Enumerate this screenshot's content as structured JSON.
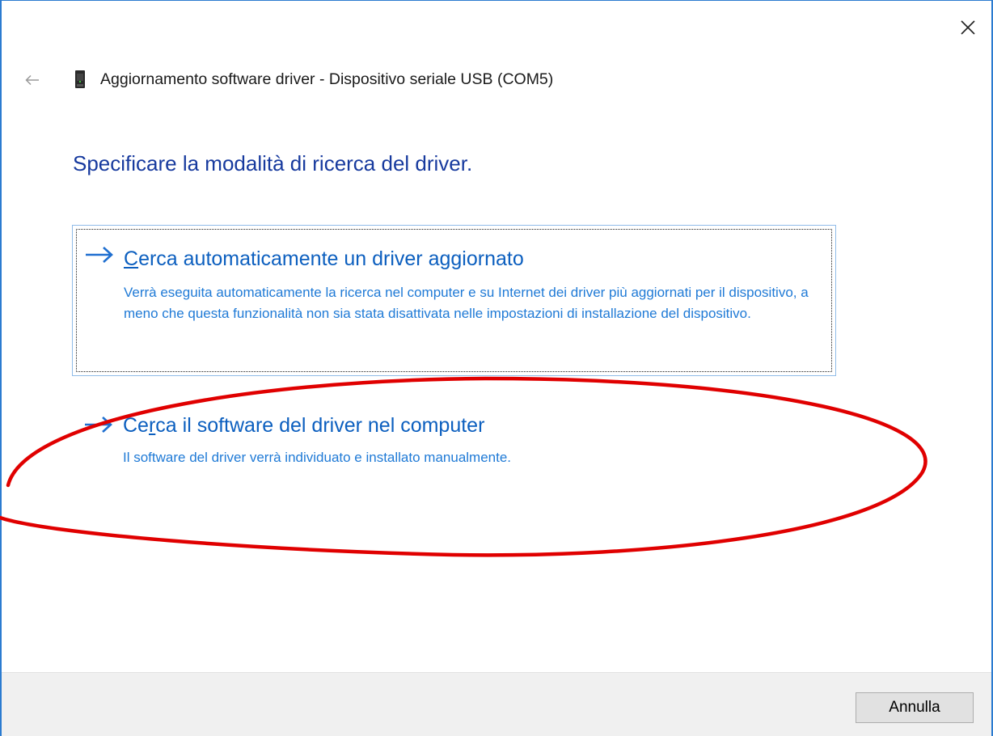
{
  "window": {
    "title": "Aggiornamento software driver - Dispositivo seriale USB (COM5)",
    "close_icon": "close-icon",
    "back_icon": "back-arrow-icon",
    "device_icon": "usb-serial-device-icon"
  },
  "main": {
    "heading": "Specificare la modalità di ricerca del driver.",
    "options": [
      {
        "accesskey": "C",
        "title_rest": "erca automaticamente un driver aggiornato",
        "description": "Verrà eseguita automaticamente la ricerca nel computer e su Internet dei driver più aggiornati per il dispositivo, a meno che questa funzionalità non sia stata disattivata nelle impostazioni di installazione del dispositivo.",
        "icon": "arrow-right-icon",
        "focused": true
      },
      {
        "title_pre": "Ce",
        "accesskey": "r",
        "title_rest": "ca il software del driver nel computer",
        "description": "Il software del driver verrà individuato e installato manualmente.",
        "icon": "arrow-right-icon",
        "focused": false,
        "highlighted_by_annotation": true
      }
    ]
  },
  "footer": {
    "cancel_label": "Annulla"
  },
  "colors": {
    "heading": "#173a9e",
    "link_title": "#0c5fbf",
    "link_description": "#1f7ad6",
    "window_border": "#2b7bd0",
    "annotation": "#e00000",
    "footer_bg": "#f0f0f0"
  }
}
